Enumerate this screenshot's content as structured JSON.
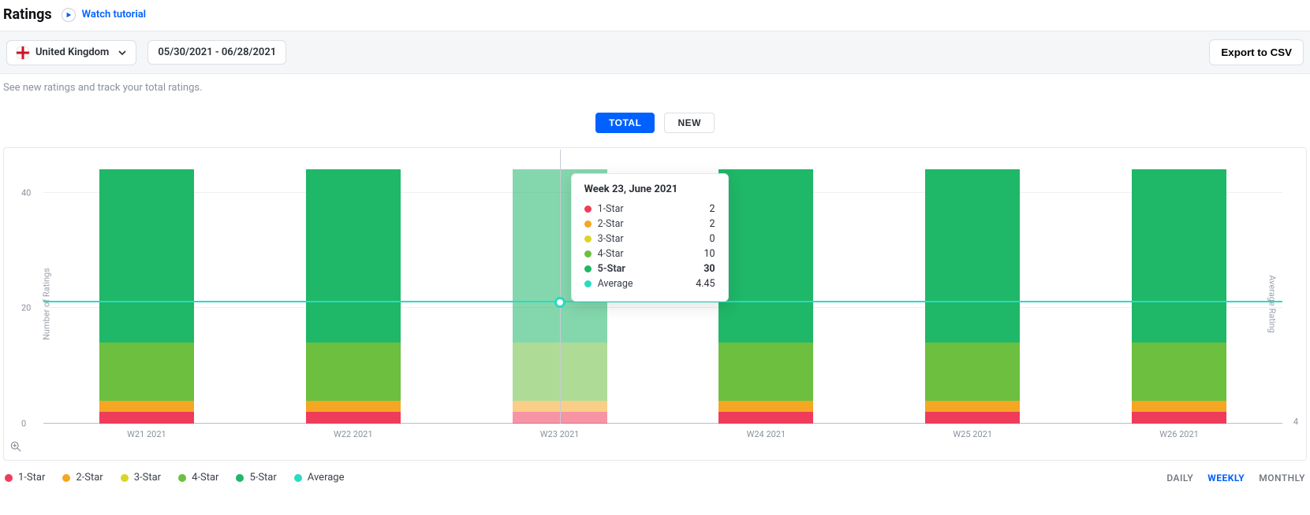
{
  "header": {
    "title": "Ratings",
    "watch_tutorial": "Watch tutorial"
  },
  "toolbar": {
    "country": "United Kingdom",
    "date_range": "05/30/2021 - 06/28/2021",
    "export_csv": "Export to CSV"
  },
  "subtitle": "See new ratings and track your total ratings.",
  "toggle": {
    "total": "TOTAL",
    "new": "NEW",
    "active": "total"
  },
  "chart_labels": {
    "y_left": "Number of Ratings",
    "y_right": "Average Rating"
  },
  "legend": [
    {
      "key": "s1",
      "label": "1-Star",
      "color": "#ef3c5b"
    },
    {
      "key": "s2",
      "label": "2-Star",
      "color": "#f5a623"
    },
    {
      "key": "s3",
      "label": "3-Star",
      "color": "#d9d52b"
    },
    {
      "key": "s4",
      "label": "4-Star",
      "color": "#6cbf3f"
    },
    {
      "key": "s5",
      "label": "5-Star",
      "color": "#1fb768"
    },
    {
      "key": "avg",
      "label": "Average",
      "color": "#2adbc3"
    }
  ],
  "granularity": {
    "daily": "DAILY",
    "weekly": "WEEKLY",
    "monthly": "MONTHLY",
    "active": "weekly"
  },
  "tooltip": {
    "title": "Week 23, June 2021",
    "rows": [
      {
        "key": "s1",
        "label": "1-Star",
        "value": "2"
      },
      {
        "key": "s2",
        "label": "2-Star",
        "value": "2"
      },
      {
        "key": "s3",
        "label": "3-Star",
        "value": "0"
      },
      {
        "key": "s4",
        "label": "4-Star",
        "value": "10"
      },
      {
        "key": "s5",
        "label": "5-Star",
        "value": "30",
        "strong": true
      },
      {
        "key": "avg",
        "label": "Average",
        "value": "4.45"
      }
    ]
  },
  "chart_data": {
    "type": "bar",
    "stacked": true,
    "overlay_line": "Average",
    "categories": [
      "W21 2021",
      "W22 2021",
      "W23 2021",
      "W24 2021",
      "W25 2021",
      "W26 2021"
    ],
    "ylabel_left": "Number of Ratings",
    "ylabel_right": "Average Rating",
    "y_ticks_left": [
      0,
      20,
      40
    ],
    "ylim_left": [
      0,
      45
    ],
    "right_tick_visible": 4,
    "series": [
      {
        "name": "1-Star",
        "color": "#ef3c5b",
        "values": [
          2,
          2,
          2,
          2,
          2,
          2
        ]
      },
      {
        "name": "2-Star",
        "color": "#f5a623",
        "values": [
          2,
          2,
          2,
          2,
          2,
          2
        ]
      },
      {
        "name": "3-Star",
        "color": "#d9d52b",
        "values": [
          0,
          0,
          0,
          0,
          0,
          0
        ]
      },
      {
        "name": "4-Star",
        "color": "#6cbf3f",
        "values": [
          10,
          10,
          10,
          10,
          10,
          10
        ]
      },
      {
        "name": "5-Star",
        "color": "#1fb768",
        "values": [
          30,
          30,
          30,
          30,
          30,
          30
        ]
      }
    ],
    "average_series": {
      "name": "Average",
      "color": "#2adbc3",
      "values": [
        4.45,
        4.45,
        4.45,
        4.45,
        4.45,
        4.45
      ]
    },
    "highlight_index": 2
  }
}
